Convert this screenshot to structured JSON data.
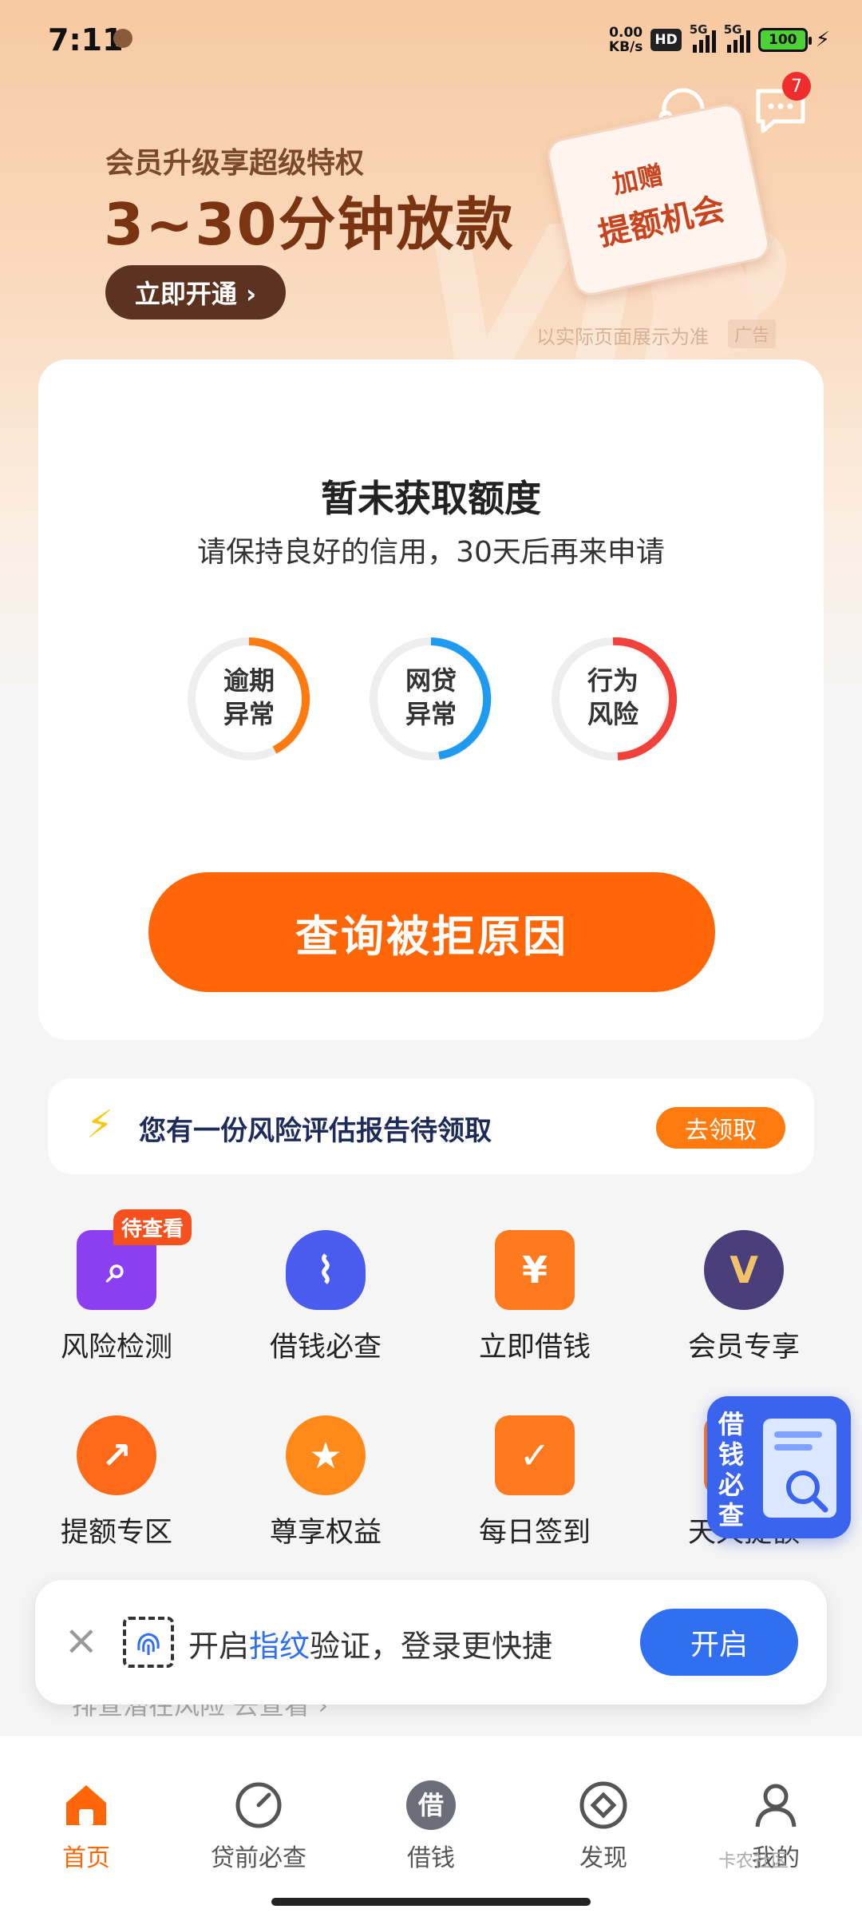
{
  "status_bar": {
    "time": "7:11",
    "net_speed_value": "0.00",
    "net_speed_unit": "KB/s",
    "hd": "HD",
    "signal1": "5G",
    "signal2": "5G",
    "battery": "100"
  },
  "header": {
    "message_badge": "7"
  },
  "banner": {
    "subtitle": "会员升级享超级特权",
    "title": "3~30分钟放款",
    "button": "立即开通 ›",
    "card_line1": "加赠",
    "card_line2": "提额机会",
    "note": "以实际页面展示为准",
    "ad_tag": "广告"
  },
  "main_card": {
    "title": "暂未获取额度",
    "subtitle": "请保持良好的信用，30天后再来申请",
    "rings": [
      {
        "line1": "逾期",
        "line2": "异常",
        "color": "#ff7a0f"
      },
      {
        "line1": "网贷",
        "line2": "异常",
        "color": "#1e9bf0"
      },
      {
        "line1": "行为",
        "line2": "风险",
        "color": "#f0413a"
      }
    ],
    "query_button": "查询被拒原因"
  },
  "report": {
    "text": "您有一份风险评估报告待领取",
    "button": "去领取"
  },
  "grid": {
    "pending_tag": "待查看",
    "items": [
      {
        "label": "风险检测",
        "icon": "search-icon",
        "color": "#8b3ff0",
        "glyph": "⌕"
      },
      {
        "label": "借钱必查",
        "icon": "shield-pulse-icon",
        "color": "#4a5cf0",
        "glyph": "⌇"
      },
      {
        "label": "立即借钱",
        "icon": "yen-envelope-icon",
        "color": "#ff7a1f",
        "glyph": "¥"
      },
      {
        "label": "会员专享",
        "icon": "vip-crown-icon",
        "color": "#4a3f7a",
        "glyph": "V"
      },
      {
        "label": "提额专区",
        "icon": "trend-up-icon",
        "color": "#ff6a1a",
        "glyph": "↗"
      },
      {
        "label": "尊享权益",
        "icon": "medal-icon",
        "color": "#ff8a1a",
        "glyph": "★"
      },
      {
        "label": "每日签到",
        "icon": "clipboard-check-icon",
        "color": "#ff7a1f",
        "glyph": "✓"
      },
      {
        "label": "天天提额",
        "icon": "daily-raise-icon",
        "color": "#ff7a1f",
        "glyph": "↑"
      }
    ]
  },
  "float_widget": {
    "text": "借钱必查"
  },
  "fingerprint": {
    "text_before": "开启",
    "text_highlight": "指纹",
    "text_after": "验证，登录更快捷",
    "button": "开启"
  },
  "peek": {
    "text": "排查潜在风险  去查看 ›"
  },
  "bottom_nav": {
    "items": [
      {
        "label": "首页",
        "icon": "home-icon"
      },
      {
        "label": "贷前必查",
        "icon": "gauge-icon"
      },
      {
        "label": "借钱",
        "icon": "borrow-icon",
        "glyph": "借"
      },
      {
        "label": "发现",
        "icon": "compass-icon"
      },
      {
        "label": "我的",
        "icon": "profile-icon"
      }
    ]
  },
  "watermark": "卡农社区"
}
